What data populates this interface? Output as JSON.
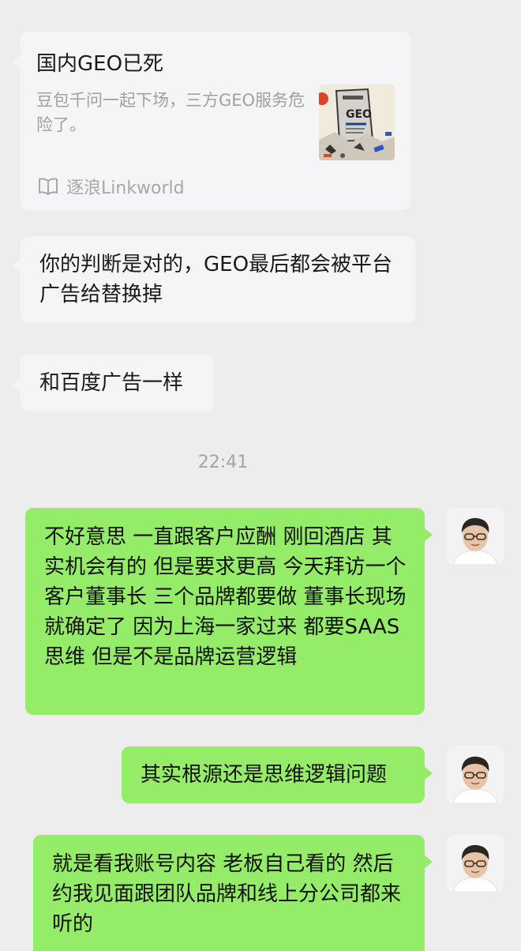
{
  "card": {
    "title": "国内GEO已死",
    "description": "豆包千问一起下场，三方GEO服务危险了。",
    "thumb_text": "GEO",
    "source": "逐浪Linkworld",
    "source_icon": "book-open-icon"
  },
  "incoming": [
    {
      "text": "你的判断是对的，GEO最后都会被平台广告给替换掉"
    },
    {
      "text": "和百度广告一样"
    }
  ],
  "timestamp": "22:41",
  "outgoing": [
    {
      "text": "不好意思 一直跟客户应酬 刚回酒店 其实机会有的 但是要求更高 今天拜访一个客户董事长 三个品牌都要做 董事长现场就确定了 因为上海一家过来 都要SAAS思维 但是不是品牌运营逻辑"
    },
    {
      "text": "其实根源还是思维逻辑问题"
    },
    {
      "text": "就是看我账号内容 老板自己看的 然后约我见面跟团队品牌和线上分公司都来听的"
    }
  ],
  "colors": {
    "background": "#ededed",
    "incoming_bubble": "#f5f5f7",
    "outgoing_bubble": "#95ec69"
  }
}
